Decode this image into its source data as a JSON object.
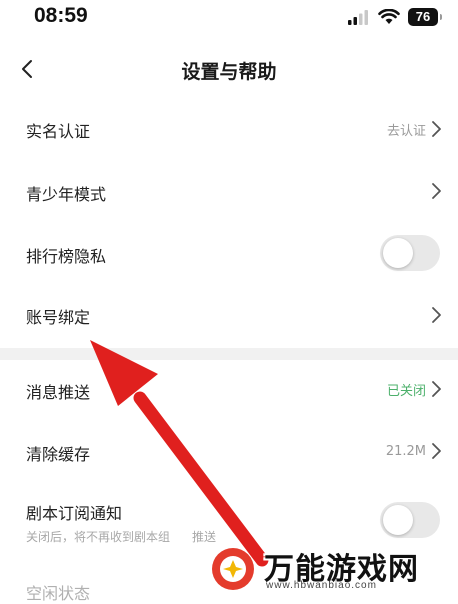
{
  "status_bar": {
    "time": "08:59",
    "battery": "76"
  },
  "header": {
    "title": "设置与帮助"
  },
  "settings": {
    "real_name": {
      "label": "实名认证",
      "value": "去认证"
    },
    "teen_mode": {
      "label": "青少年模式"
    },
    "ranking_privacy": {
      "label": "排行榜隐私",
      "toggle_on": false
    },
    "account_binding": {
      "label": "账号绑定"
    },
    "push": {
      "label": "消息推送",
      "value": "已关闭"
    },
    "cache": {
      "label": "清除缓存",
      "value": "21.2M"
    },
    "script_notice": {
      "label": "剧本订阅通知",
      "sub": "关闭后，将不再收到剧本组",
      "sub_tail": "推送",
      "toggle_on": false
    },
    "idle": {
      "label": "空闲状态"
    }
  },
  "watermark": {
    "text": "万能游戏网",
    "url": "www.hbwanbiao.com"
  },
  "colors": {
    "accent_green": "#4cb06b",
    "arrow_red": "#e0201e",
    "toggle_off": "#e8e8e8"
  }
}
